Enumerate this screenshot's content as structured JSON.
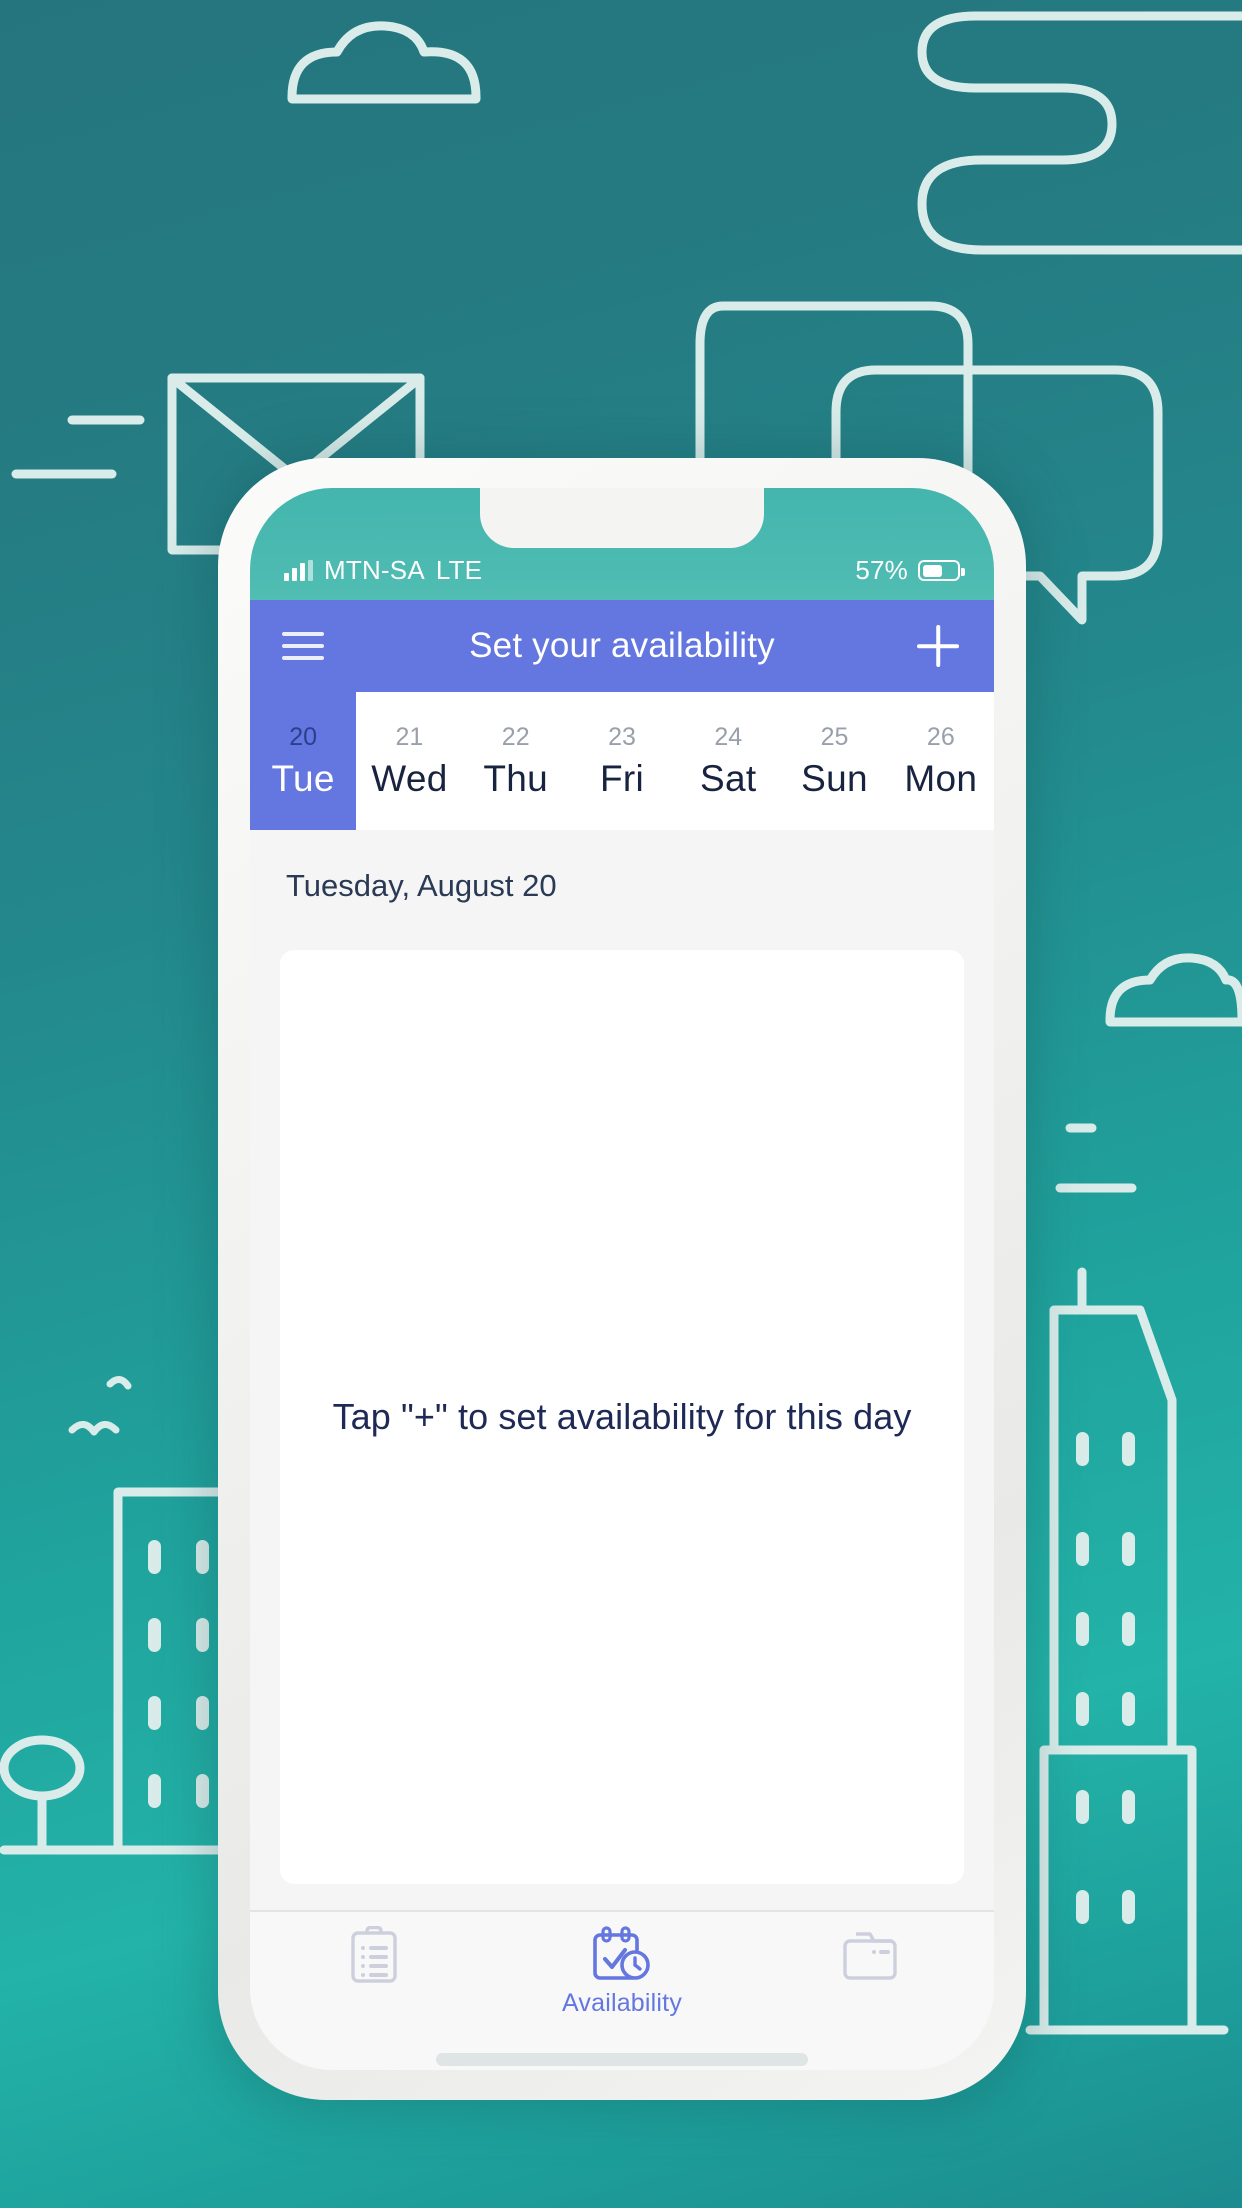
{
  "phone": {
    "status_bar": {
      "carrier": "MTN-SA",
      "network": "LTE",
      "battery_percent": "57%",
      "signal_icon": "signal-bars-icon",
      "battery_icon": "battery-icon"
    },
    "home_indicator": "home-indicator-bar"
  },
  "app_bar": {
    "title": "Set your availability",
    "menu_icon": "hamburger-menu-icon",
    "add_icon": "plus-icon",
    "background_color": "#6476e0"
  },
  "date_strip": {
    "days": [
      {
        "num": "20",
        "name": "Tue",
        "selected": true
      },
      {
        "num": "21",
        "name": "Wed",
        "selected": false
      },
      {
        "num": "22",
        "name": "Thu",
        "selected": false
      },
      {
        "num": "23",
        "name": "Fri",
        "selected": false
      },
      {
        "num": "24",
        "name": "Sat",
        "selected": false
      },
      {
        "num": "25",
        "name": "Sun",
        "selected": false
      },
      {
        "num": "26",
        "name": "Mon",
        "selected": false
      }
    ]
  },
  "content": {
    "selected_date_label": "Tuesday, August 20",
    "empty_state_message": "Tap \"+\" to set availability for this day"
  },
  "bottom_nav": {
    "items": [
      {
        "label": "",
        "icon": "clipboard-icon",
        "active": false
      },
      {
        "label": "Availability",
        "icon": "calendar-clock-icon",
        "active": true
      },
      {
        "label": "",
        "icon": "folder-icon",
        "active": false
      }
    ],
    "active_color": "#6476e0",
    "inactive_color": "#cdcfdd"
  },
  "background": {
    "gradient_from": "#25757e",
    "gradient_to": "#1d8b8f",
    "line_art_color": "#d9ecea",
    "motifs": [
      "cloud-icon",
      "envelope-icon",
      "speech-bubble-icon",
      "winding-path-icon",
      "building-icon",
      "tree-icon",
      "bird-icon"
    ]
  }
}
